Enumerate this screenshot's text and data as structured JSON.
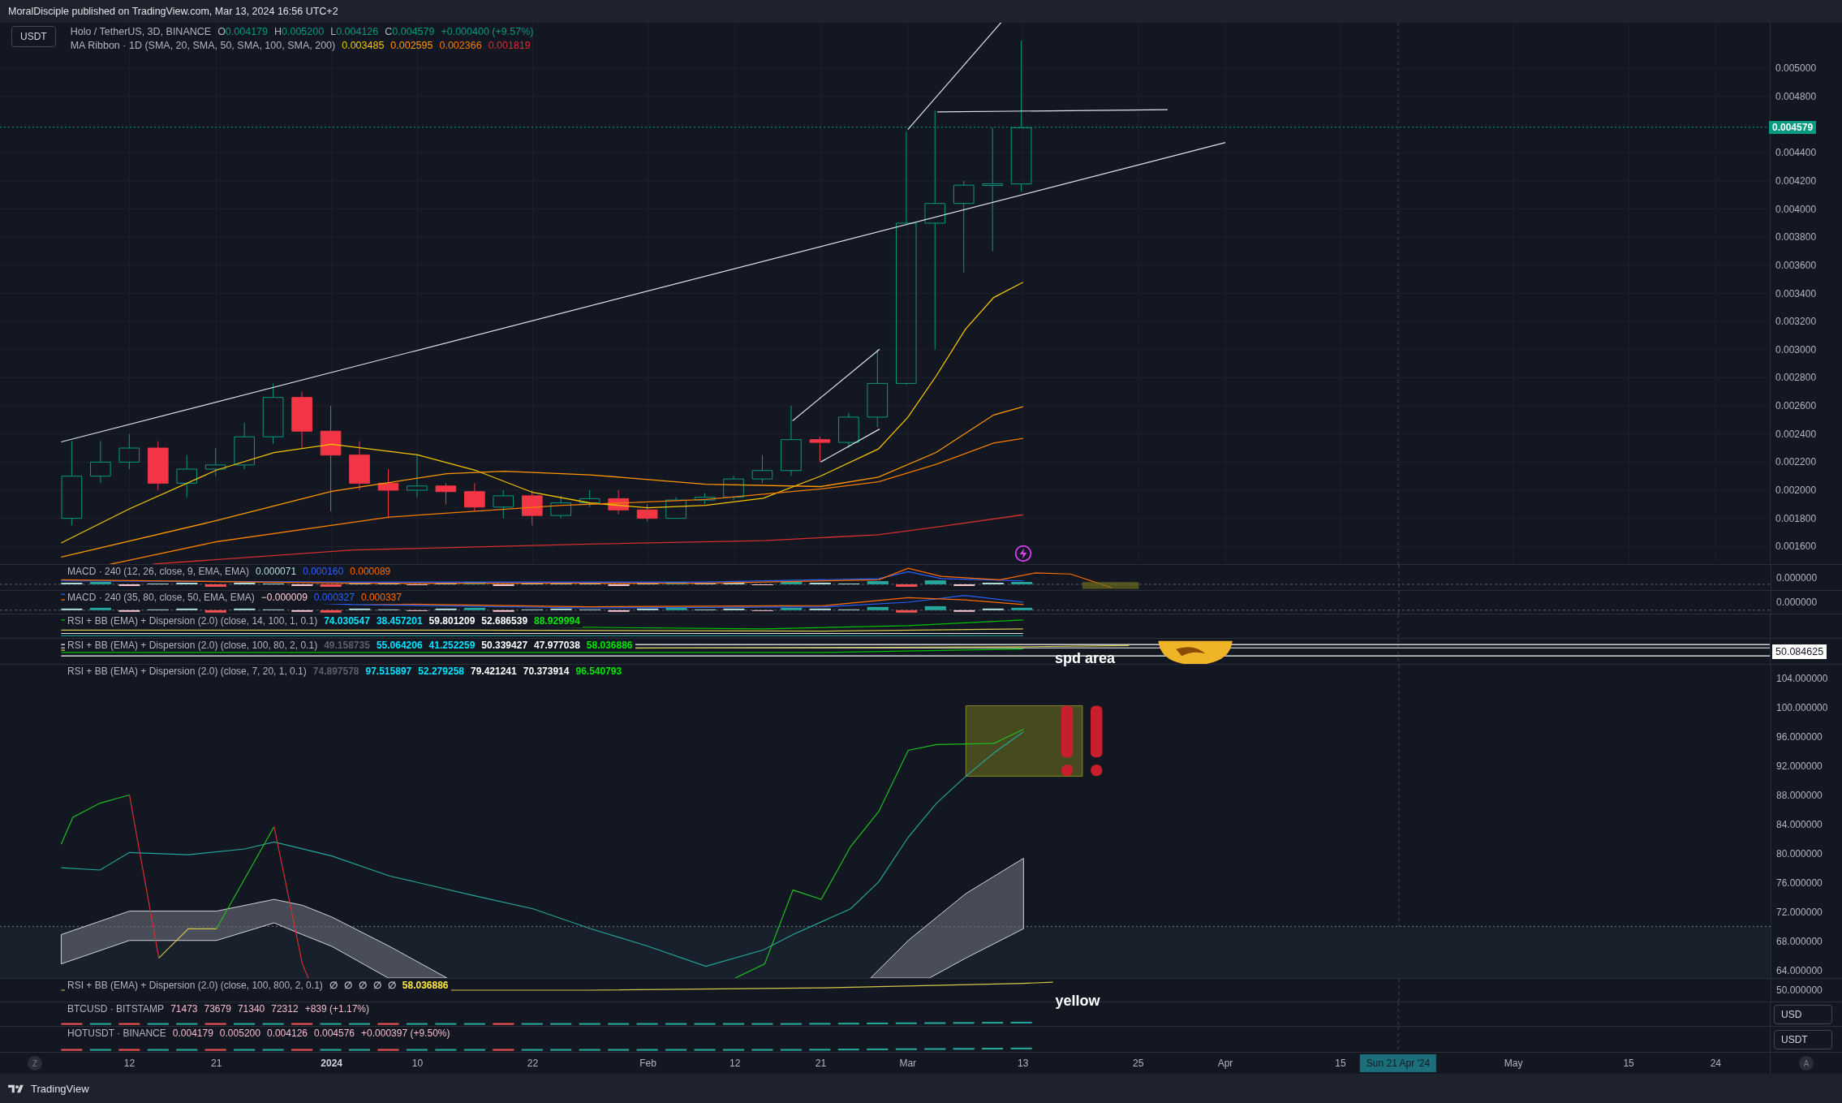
{
  "header": {
    "text": "MoralDisciple published on TradingView.com, Mar 13, 2024 16:56 UTC+2"
  },
  "symbol_button": {
    "label": "USDT"
  },
  "main_pane": {
    "legend": {
      "title": "Holo / TetherUS, 3D, BINANCE",
      "ohlc": [
        {
          "label": "O",
          "value": "0.004179"
        },
        {
          "label": "H",
          "value": "0.005200"
        },
        {
          "label": "L",
          "value": "0.004126"
        },
        {
          "label": "C",
          "value": "0.004579"
        }
      ],
      "change": "+0.000400 (+9.57%)"
    },
    "ma_ribbon": {
      "title": "MA Ribbon · 1D (SMA, 20, SMA, 50, SMA, 100, SMA, 200)",
      "values": [
        {
          "text": "0.003485",
          "color": "#f5c400"
        },
        {
          "text": "0.002595",
          "color": "#ff9800"
        },
        {
          "text": "0.002366",
          "color": "#f57c00"
        },
        {
          "text": "0.001819",
          "color": "#d32f2f"
        }
      ]
    },
    "price_axis": {
      "labels": [
        "0.005000",
        "0.004800",
        "0.004400",
        "0.004200",
        "0.004000",
        "0.003800",
        "0.003600",
        "0.003400",
        "0.003200",
        "0.003000",
        "0.002800",
        "0.002600",
        "0.002400",
        "0.002200",
        "0.002000",
        "0.001800",
        "0.001600"
      ],
      "current_price": "0.004579"
    }
  },
  "panes": [
    {
      "kind": "macd",
      "title": "MACD · 240 (12, 26, close, 9, EMA, EMA)",
      "values": [
        {
          "text": "0.000071",
          "color": "#b2dfdb"
        },
        {
          "text": "0.000160",
          "color": "#2962ff"
        },
        {
          "text": "0.000089",
          "color": "#ff6d00"
        }
      ],
      "axis": {
        "kind": "labels",
        "labels": [
          "0.000000"
        ]
      }
    },
    {
      "kind": "macd",
      "title": "MACD · 240 (35, 80, close, 50, EMA, EMA)",
      "values": [
        {
          "text": "−0.000009",
          "color": "#ffcdd2"
        },
        {
          "text": "0.000327",
          "color": "#2962ff"
        },
        {
          "text": "0.000337",
          "color": "#ff6d00"
        }
      ],
      "axis": {
        "kind": "labels",
        "labels": [
          "0.000000"
        ]
      }
    },
    {
      "kind": "rsi",
      "title": "RSI + BB (EMA) + Dispersion (2.0) (close, 14, 100, 1, 0.1)",
      "values": [
        {
          "text": "74.030547",
          "color": "#00e5ff"
        },
        {
          "text": "38.457201",
          "color": "#00e5ff"
        },
        {
          "text": "59.801209",
          "color": "#ffffff"
        },
        {
          "text": "52.686539",
          "color": "#ffffff"
        },
        {
          "text": "88.929994",
          "color": "#00e600"
        }
      ],
      "axis": {
        "kind": "none"
      }
    },
    {
      "kind": "rsi",
      "title": "RSI + BB (EMA) + Dispersion (2.0) (close, 100, 80, 2, 0.1)",
      "values": [
        {
          "text": "49.158735",
          "color": "#5d606b"
        },
        {
          "text": "55.064206",
          "color": "#00e5ff"
        },
        {
          "text": "41.252259",
          "color": "#00e5ff"
        },
        {
          "text": "50.339427",
          "color": "#ffffff"
        },
        {
          "text": "47.977038",
          "color": "#ffffff"
        },
        {
          "text": "58.036886",
          "color": "#00e600"
        }
      ],
      "axis": {
        "kind": "badge",
        "labels": [
          "50.084625"
        ]
      },
      "note": "spd area"
    },
    {
      "kind": "rsi",
      "title": "RSI + BB (EMA) + Dispersion (2.0) (close, 7, 20, 1, 0.1)",
      "values": [
        {
          "text": "74.897578",
          "color": "#5d606b"
        },
        {
          "text": "97.515897",
          "color": "#00e5ff"
        },
        {
          "text": "52.279258",
          "color": "#00e5ff"
        },
        {
          "text": "79.421241",
          "color": "#ffffff"
        },
        {
          "text": "70.373914",
          "color": "#ffffff"
        },
        {
          "text": "96.540793",
          "color": "#00e600"
        }
      ],
      "axis": {
        "kind": "labels",
        "labels": [
          "104.000000",
          "100.000000",
          "96.000000",
          "92.000000",
          "88.000000",
          "84.000000",
          "80.000000",
          "76.000000",
          "72.000000",
          "68.000000",
          "64.000000"
        ]
      }
    },
    {
      "kind": "rsi",
      "title": "RSI + BB (EMA) + Dispersion (2.0) (close, 100, 800, 2, 0.1)",
      "values": [
        {
          "text": "∅",
          "color": "#b2b5be"
        },
        {
          "text": "∅",
          "color": "#b2b5be"
        },
        {
          "text": "∅",
          "color": "#b2b5be"
        },
        {
          "text": "∅",
          "color": "#b2b5be"
        },
        {
          "text": "∅",
          "color": "#b2b5be"
        },
        {
          "text": "58.036886",
          "color": "#ffeb3b"
        }
      ],
      "axis": {
        "kind": "labels",
        "labels": [
          "50.000000"
        ]
      },
      "note": "yellow"
    },
    {
      "kind": "symbol",
      "title": "BTCUSD · BITSTAMP",
      "values": [
        {
          "text": "71473"
        },
        {
          "text": "73679"
        },
        {
          "text": "71340"
        },
        {
          "text": "72312"
        },
        {
          "text": "+839 (+1.17%)"
        }
      ],
      "axis": {
        "kind": "button",
        "labels": [
          "USD"
        ]
      }
    },
    {
      "kind": "symbol",
      "title": "HOTUSDT · BINANCE",
      "values": [
        {
          "text": "0.004179"
        },
        {
          "text": "0.005200"
        },
        {
          "text": "0.004126"
        },
        {
          "text": "0.004576"
        },
        {
          "text": "+0.000397 (+9.50%)"
        }
      ],
      "axis": {
        "kind": "button",
        "labels": [
          "USDT"
        ]
      }
    }
  ],
  "time_axis": {
    "left_button": "Z",
    "right_button": "A",
    "labels": [
      {
        "text": "12",
        "bold": false
      },
      {
        "text": "21",
        "bold": false
      },
      {
        "text": "2024",
        "bold": true
      },
      {
        "text": "10",
        "bold": false
      },
      {
        "text": "22",
        "bold": false
      },
      {
        "text": "Feb",
        "bold": false
      },
      {
        "text": "12",
        "bold": false
      },
      {
        "text": "21",
        "bold": false
      },
      {
        "text": "Mar",
        "bold": false
      },
      {
        "text": "13",
        "bold": false
      },
      {
        "text": "25",
        "bold": false
      },
      {
        "text": "Apr",
        "bold": false
      },
      {
        "text": "15",
        "bold": false
      },
      {
        "text": "May",
        "bold": false
      },
      {
        "text": "15",
        "bold": false
      },
      {
        "text": "24",
        "bold": false
      }
    ],
    "crosshair": "Sun 21 Apr '24"
  },
  "footer": {
    "brand": "TradingView"
  }
}
